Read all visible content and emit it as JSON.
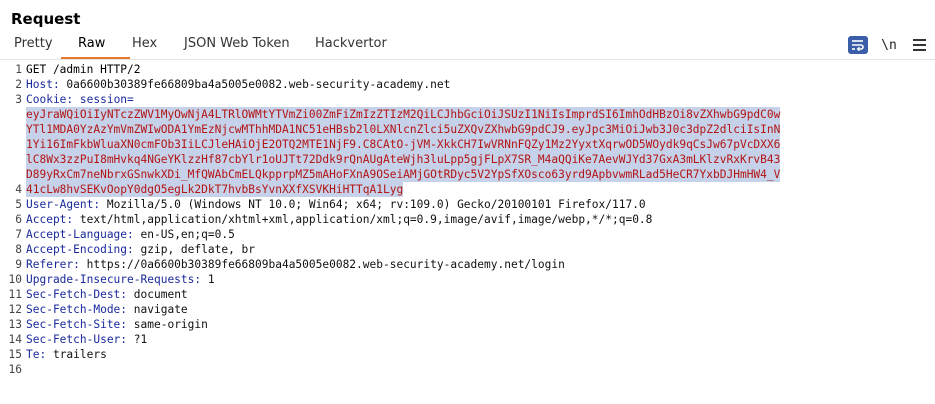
{
  "panel": {
    "title": "Request"
  },
  "tabs": [
    {
      "label": "Pretty",
      "active": false
    },
    {
      "label": "Raw",
      "active": true
    },
    {
      "label": "Hex",
      "active": false
    },
    {
      "label": "JSON Web Token",
      "active": false
    },
    {
      "label": "Hackvertor",
      "active": false
    }
  ],
  "toolbar": {
    "wrap_icon": "wrap-lines-icon",
    "newline_label": "\\n",
    "menu_icon": "hamburger-menu-icon",
    "accent_color": "#3a5ea8"
  },
  "editor": {
    "line_numbers": [
      "1",
      "2",
      "3",
      "",
      "",
      "",
      "",
      "",
      "4",
      "5",
      "6",
      "7",
      "8",
      "9",
      "10",
      "11",
      "12",
      "13",
      "14",
      "15",
      "16"
    ],
    "request_line": "GET /admin HTTP/2",
    "host": {
      "name": "Host:",
      "value": " 0a6600b30389fe66809ba4a5005e0082.web-security-academy.net"
    },
    "cookie": {
      "name": "Cookie:",
      "key": " session="
    },
    "token_lines": [
      "eyJraWQiOiIyNTczZWV1MyOwNjA4LTRlOWMtYTVmZi00ZmFiZmIzZTIzM2QiLCJhbGciOiJSUzI1NiIsImprdSI6ImhOdHBzOi8vZXhwbG9pdC0w",
      "YTl1MDA0YzAzYmVmZWIwODA1YmEzNjcwMThhMDA1NC51eHBsb2l0LXNlcnZlci5uZXQvZXhwbG9pdCJ9.eyJpc3MiOiJwb3J0c3dpZ2dlciIsInN",
      "1Yi16ImFkbWluaXN0cmFOb3IiLCJleHAiOjE2OTQ2MTE1NjF9.C8CAtO-jVM-XkkCH7IwVRNnFQZy1Mz2YyxtXqrwOD5WOydk9qCsJw67pVcDXX6",
      "lC8Wx3zzPuI8mHvkq4NGeYKlzzHf87cbYlr1oUJTt72Ddk9rQnAUgAteWjh3luLpp5gjFLpX7SR_M4aQQiKe7AevWJYd37GxA3mLKlzvRxKrvB43",
      "D89yRxCm7neNbrxGSnwkXDi_MfQWAbCmELQkpprpMZ5mAHoFXnA9OSeiAMjGOtRDyc5V2YpSfXOsco63yrd9ApbvwmRLad5HeCR7YxbDJHmHW4_V",
      "41cLw8hvSEKvOopY0dgO5egLk2DkT7hvbBsYvnXXfXSVKHiHTTqA1Lyg"
    ],
    "headers": [
      {
        "name": "User-Agent:",
        "value": " Mozilla/5.0 (Windows NT 10.0; Win64; x64; rv:109.0) Gecko/20100101 Firefox/117.0"
      },
      {
        "name": "Accept:",
        "value": " text/html,application/xhtml+xml,application/xml;q=0.9,image/avif,image/webp,*/*;q=0.8"
      },
      {
        "name": "Accept-Language:",
        "value": " en-US,en;q=0.5"
      },
      {
        "name": "Accept-Encoding:",
        "value": " gzip, deflate, br"
      },
      {
        "name": "Referer:",
        "value": " https://0a6600b30389fe66809ba4a5005e0082.web-security-academy.net/login"
      },
      {
        "name": "Upgrade-Insecure-Requests:",
        "value": " 1"
      },
      {
        "name": "Sec-Fetch-Dest:",
        "value": " document"
      },
      {
        "name": "Sec-Fetch-Mode:",
        "value": " navigate"
      },
      {
        "name": "Sec-Fetch-Site:",
        "value": " same-origin"
      },
      {
        "name": "Sec-Fetch-User:",
        "value": " ?1"
      },
      {
        "name": "Te:",
        "value": " trailers"
      }
    ]
  }
}
